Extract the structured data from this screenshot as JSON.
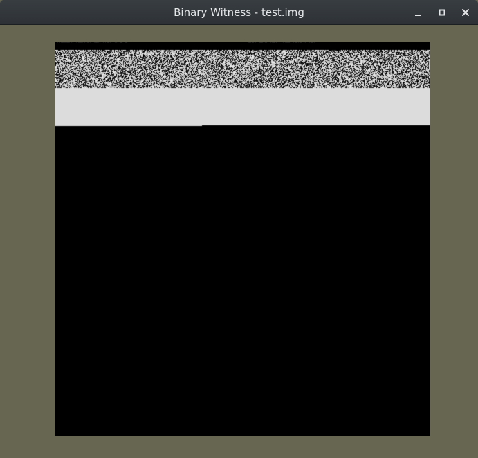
{
  "window": {
    "title": "Binary Witness - test.img",
    "controls": [
      "minimize-icon",
      "maximize-icon",
      "close-icon"
    ]
  },
  "colors": {
    "desktop_background": "#676751",
    "titlebar": "#33383c",
    "title_text": "#e4e6e7",
    "view_background": "#000000",
    "light_band": "#dcdcdc",
    "noise_light": "#dddddd"
  }
}
